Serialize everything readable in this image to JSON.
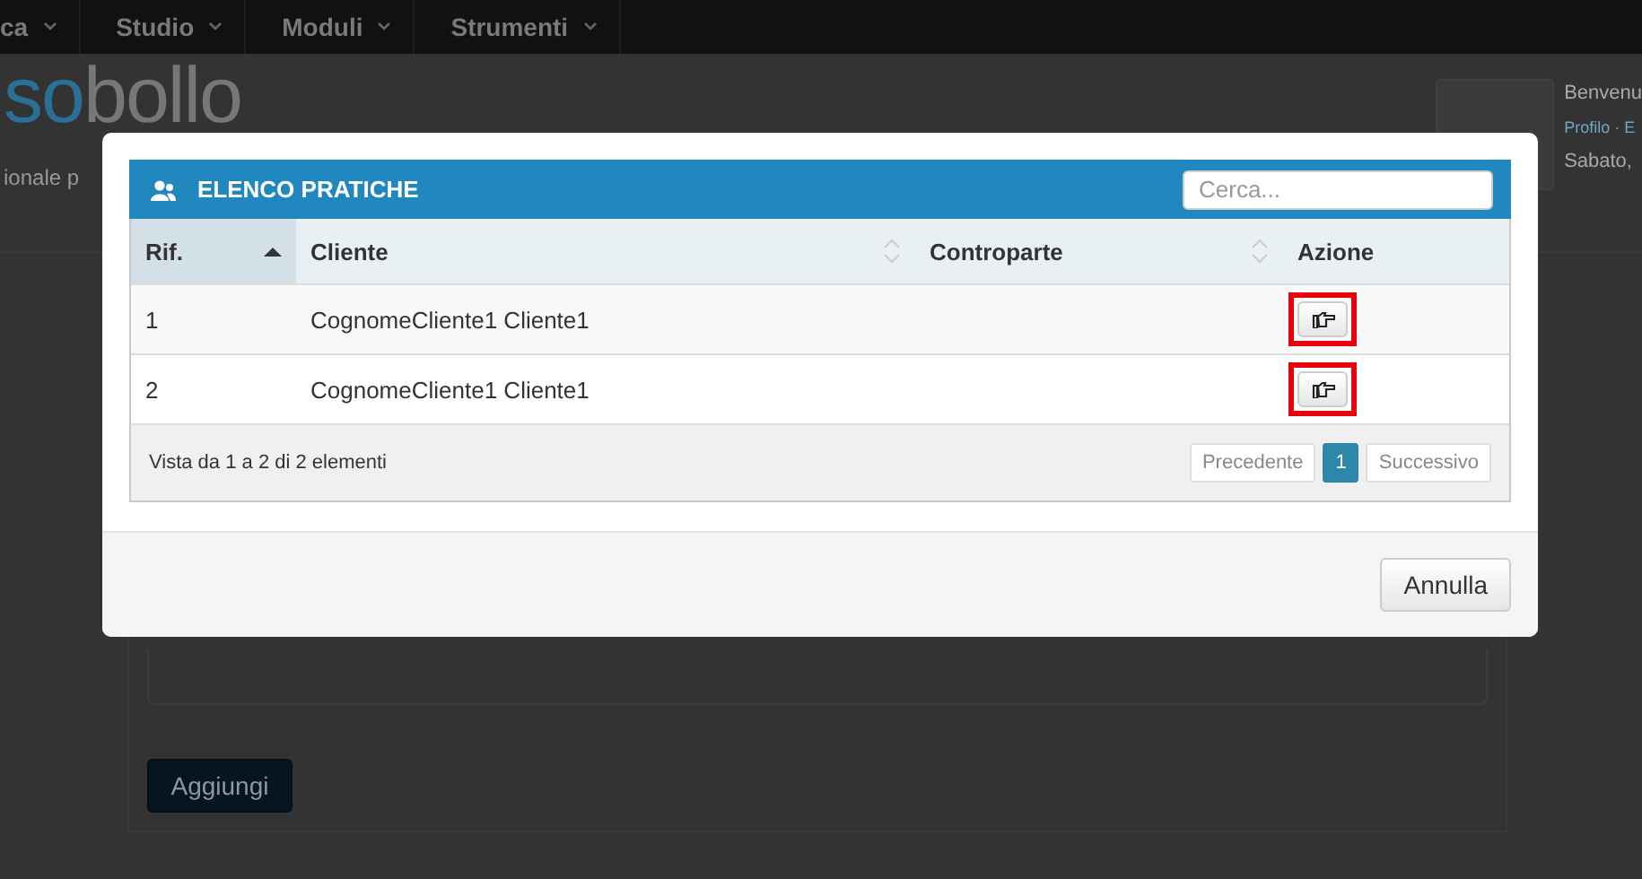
{
  "background": {
    "nav": [
      {
        "label": "ca"
      },
      {
        "label": "Studio"
      },
      {
        "label": "Moduli"
      },
      {
        "label": "Strumenti"
      }
    ],
    "logo": {
      "part_1": "so",
      "part_2": "bollo",
      "tagline": "ionale p"
    },
    "user": {
      "greeting": "Benvenu",
      "links": "Profilo · E",
      "date": "Sabato,"
    },
    "add_button": "Aggiungi"
  },
  "modal": {
    "widget": {
      "title": "ELENCO PRATICHE",
      "search": {
        "placeholder": "Cerca..."
      },
      "table": {
        "columns": [
          {
            "label": "Rif.",
            "sortable": true,
            "sorted": true
          },
          {
            "label": "Cliente",
            "sortable": true,
            "sorted": false
          },
          {
            "label": "Controparte",
            "sortable": true,
            "sorted": false
          },
          {
            "label": "Azione",
            "sortable": false,
            "sorted": false
          }
        ],
        "rows": [
          {
            "rif": "1",
            "cliente": "CognomeCliente1 Cliente1",
            "highlighted": true
          },
          {
            "rif": "2",
            "cliente": "CognomeCliente1 Cliente1",
            "highlighted": true
          }
        ]
      },
      "info": "Vista da 1 a 2 di 2 elementi",
      "pagination": [
        {
          "label": "Precedente",
          "selected": false,
          "disabled": true
        },
        {
          "label": "1",
          "selected": true,
          "disabled": false
        },
        {
          "label": "Successivo",
          "selected": false,
          "disabled": true
        }
      ]
    },
    "buttons": [
      {
        "label": "Annulla"
      }
    ]
  }
}
